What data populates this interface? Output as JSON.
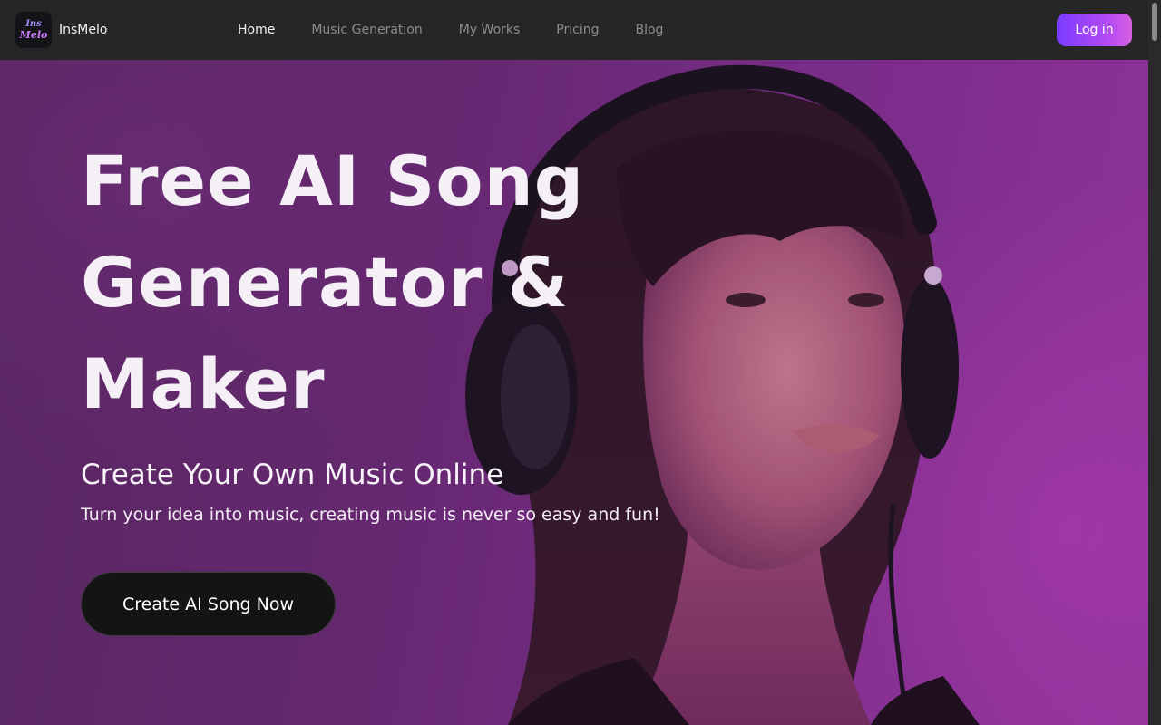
{
  "brand": {
    "logo_line1": "Ins",
    "logo_line2": "Melo",
    "name": "InsMelo"
  },
  "nav": {
    "items": [
      {
        "label": "Home",
        "active": true
      },
      {
        "label": "Music Generation",
        "active": false
      },
      {
        "label": "My Works",
        "active": false
      },
      {
        "label": "Pricing",
        "active": false
      },
      {
        "label": "Blog",
        "active": false
      }
    ],
    "login_label": "Log in"
  },
  "hero": {
    "title_line1": "Free AI Song",
    "title_line2": "Generator &",
    "title_line3": "Maker",
    "subtitle": "Create Your Own Music Online",
    "description": "Turn your idea into music, creating music is never so easy and fun!",
    "cta_label": "Create AI Song Now"
  },
  "colors": {
    "navbar_bg": "#262626",
    "hero_purple": "#7a2e86",
    "accent_gradient_start": "#7a3cff",
    "accent_gradient_end": "#d760e0",
    "cta_bg": "#141414"
  }
}
